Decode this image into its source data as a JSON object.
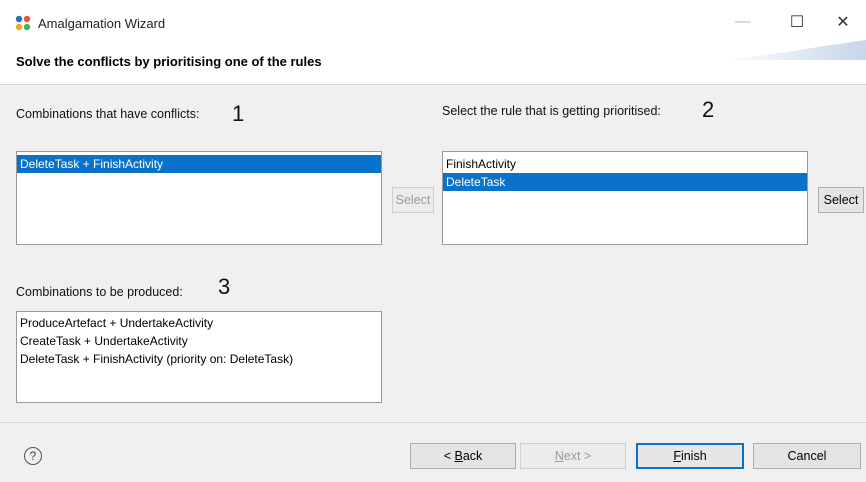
{
  "window": {
    "title": "Amalgamation Wizard",
    "minimize": "—",
    "maximize": "☐",
    "close": "✕"
  },
  "header": {
    "title": "Solve the conflicts by prioritising one of the rules"
  },
  "conflicts": {
    "label": "Combinations that have conflicts:",
    "step": "1",
    "items": [
      "DeleteTask + FinishActivity"
    ],
    "selected_index": 0,
    "select_label": "Select"
  },
  "rule": {
    "label": "Select the rule that is getting prioritised:",
    "step": "2",
    "items": [
      "FinishActivity",
      "DeleteTask"
    ],
    "selected_index": 1,
    "select_label": "Select"
  },
  "produced": {
    "label": "Combinations to be produced:",
    "step": "3",
    "items": [
      "ProduceArtefact + UndertakeActivity",
      "CreateTask + UndertakeActivity",
      "DeleteTask + FinishActivity (priority on: DeleteTask)"
    ]
  },
  "footer": {
    "help": "?",
    "back_prefix": "< ",
    "back_mnemonic": "B",
    "back_rest": "ack",
    "next_mnemonic": "N",
    "next_rest": "ext >",
    "finish_mnemonic": "F",
    "finish_rest": "inish",
    "cancel": "Cancel"
  },
  "colors": {
    "selection": "#0a72c9",
    "body_bg": "#f0f0f0"
  }
}
